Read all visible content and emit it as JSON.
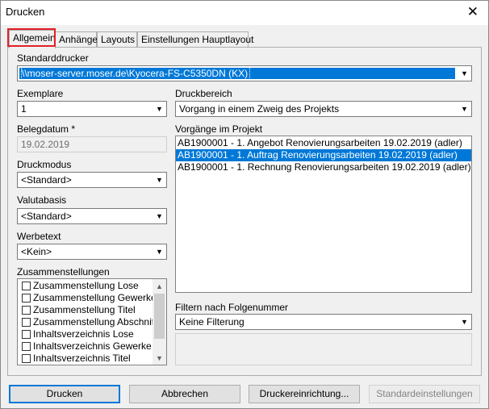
{
  "window": {
    "title": "Drucken",
    "close_glyph": "✕"
  },
  "tabs": [
    "Allgemein",
    "Anhänge",
    "Layouts",
    "Einstellungen Hauptlayout"
  ],
  "form": {
    "standarddrucker": {
      "label": "Standarddrucker",
      "value": "\\\\moser-server.moser.de\\Kyocera-FS-C5350DN (KX)"
    },
    "exemplare": {
      "label": "Exemplare",
      "value": "1"
    },
    "druckbereich": {
      "label": "Druckbereich",
      "value": "Vorgang in einem Zweig des Projekts"
    },
    "belegdatum": {
      "label": "Belegdatum *",
      "value": "19.02.2019"
    },
    "druckmodus": {
      "label": "Druckmodus",
      "value": "<Standard>"
    },
    "valutabasis": {
      "label": "Valutabasis",
      "value": "<Standard>"
    },
    "werbetext": {
      "label": "Werbetext",
      "value": "<Kein>"
    },
    "zusammenstellungen": {
      "label": "Zusammenstellungen",
      "items": [
        "Zusammenstellung Lose",
        "Zusammenstellung Gewerke",
        "Zusammenstellung Titel",
        "Zusammenstellung Abschnitte",
        "Inhaltsverzeichnis Lose",
        "Inhaltsverzeichnis Gewerke",
        "Inhaltsverzeichnis Titel"
      ]
    },
    "vorgaenge": {
      "label": "Vorgänge im Projekt",
      "items": [
        "AB1900001 - 1. Angebot Renovierungsarbeiten 19.02.2019 (adler)",
        "AB1900001 - 1. Auftrag Renovierungsarbeiten 19.02.2019 (adler)",
        "AB1900001 - 1. Rechnung Renovierungsarbeiten 19.02.2019 (adler)"
      ],
      "selected_index": 1
    },
    "filtern": {
      "label": "Filtern nach Folgenummer",
      "value": "Keine Filterung"
    }
  },
  "buttons": {
    "drucken": "Drucken",
    "abbrechen": "Abbrechen",
    "druckereinrichtung": "Druckereinrichtung...",
    "standardeinstellungen": "Standardeinstellungen"
  },
  "colors": {
    "highlight": "#0078d7",
    "tab_marker": "#e3202a"
  }
}
